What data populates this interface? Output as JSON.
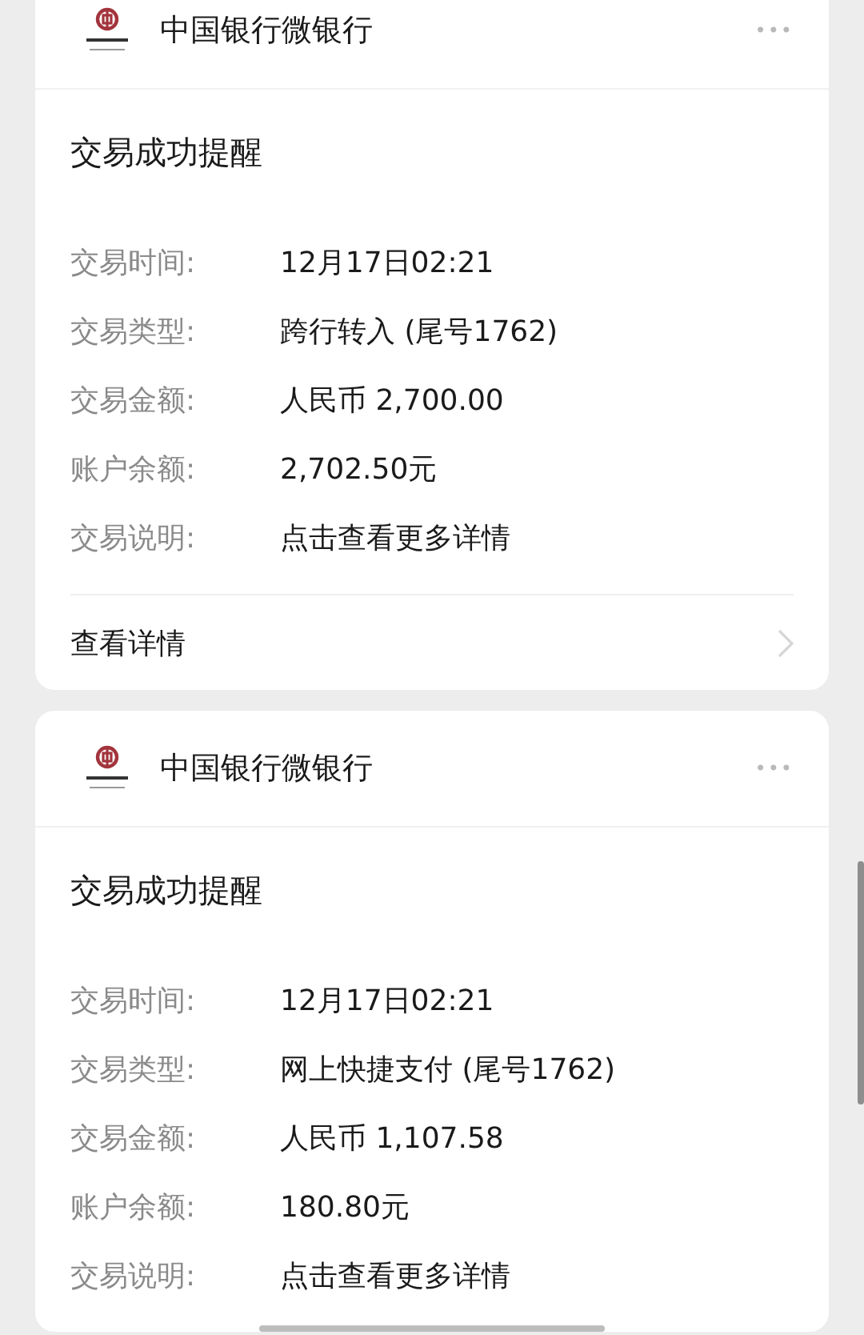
{
  "cards": [
    {
      "sender": "中国银行微银行",
      "more": "•••",
      "title": "交易成功提醒",
      "fields": [
        {
          "label": "交易时间:",
          "value": "12月17日02:21"
        },
        {
          "label": "交易类型:",
          "value": "跨行转入 (尾号1762)"
        },
        {
          "label": "交易金额:",
          "value": "人民币 2,700.00"
        },
        {
          "label": "账户余额:",
          "value": "2,702.50元"
        },
        {
          "label": "交易说明:",
          "value": "点击查看更多详情"
        }
      ],
      "footer": "查看详情"
    },
    {
      "sender": "中国银行微银行",
      "more": "•••",
      "title": "交易成功提醒",
      "fields": [
        {
          "label": "交易时间:",
          "value": "12月17日02:21"
        },
        {
          "label": "交易类型:",
          "value": "网上快捷支付 (尾号1762)"
        },
        {
          "label": "交易金额:",
          "value": "人民币 1,107.58"
        },
        {
          "label": "账户余额:",
          "value": "180.80元"
        },
        {
          "label": "交易说明:",
          "value": "点击查看更多详情"
        }
      ]
    }
  ]
}
